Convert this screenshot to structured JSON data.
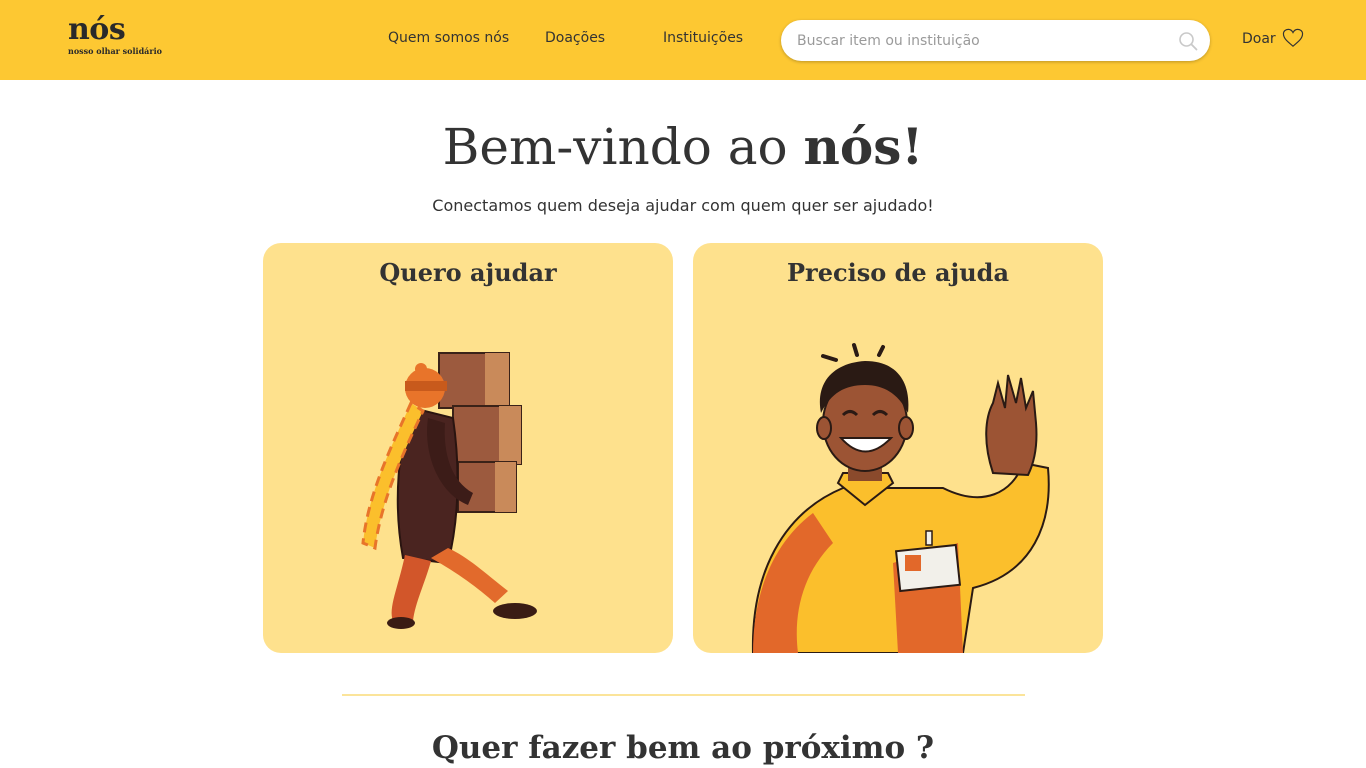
{
  "header": {
    "logo_title": "nós",
    "logo_subtitle": "nosso olhar solidário",
    "nav": [
      "Quem somos nós",
      "Doações",
      "Instituições"
    ],
    "search_placeholder": "Buscar item ou instituição",
    "donate_label": "Doar"
  },
  "hero": {
    "title_regular": "Bem-vindo ao ",
    "title_bold": "nós!",
    "subtitle": "Conectamos quem deseja ajudar com quem quer ser ajudado!"
  },
  "cards": [
    {
      "title": "Quero ajudar",
      "illustration": "person-carrying-boxes"
    },
    {
      "title": "Preciso de ajuda",
      "illustration": "smiling-man-waving"
    }
  ],
  "section": {
    "title": "Quer fazer bem ao próximo ?"
  },
  "colors": {
    "header_bg": "#fdc832",
    "card_bg": "#fee18d",
    "text": "#333333",
    "orange": "#e8742a",
    "yellow": "#fbbf2c"
  }
}
